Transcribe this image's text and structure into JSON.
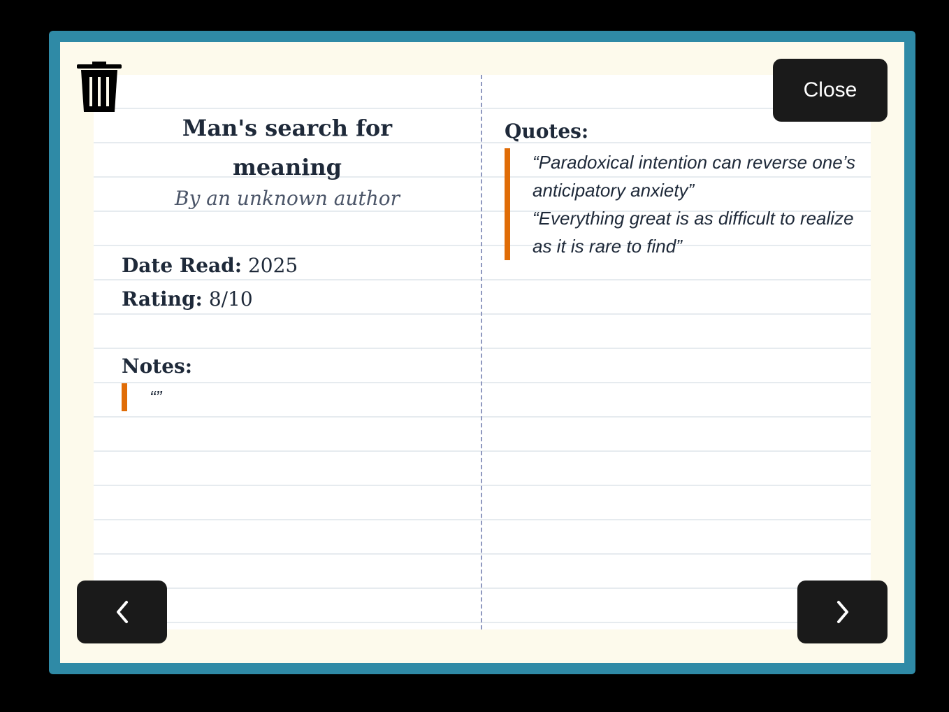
{
  "book": {
    "title": "Man's search for meaning",
    "author": "By an unknown author",
    "date_read_label": "Date Read:",
    "date_read_value": "2025",
    "rating_label": "Rating:",
    "rating_value": "8/10"
  },
  "notes": {
    "label": "Notes:",
    "items": [
      "“”"
    ]
  },
  "quotes": {
    "label": "Quotes:",
    "items": [
      "“Paradoxical intention can reverse one’s anticipatory anxiety”",
      "“Everything great is as difficult to realize as it is rare to find”"
    ]
  },
  "controls": {
    "close_label": "Close",
    "delete_icon": "trash-icon",
    "prev_icon": "chevron-left-icon",
    "next_icon": "chevron-right-icon"
  },
  "colors": {
    "frame": "#2f8aa6",
    "background": "#fdfaec",
    "accent": "#e06c06",
    "button": "#1a1a1a"
  }
}
